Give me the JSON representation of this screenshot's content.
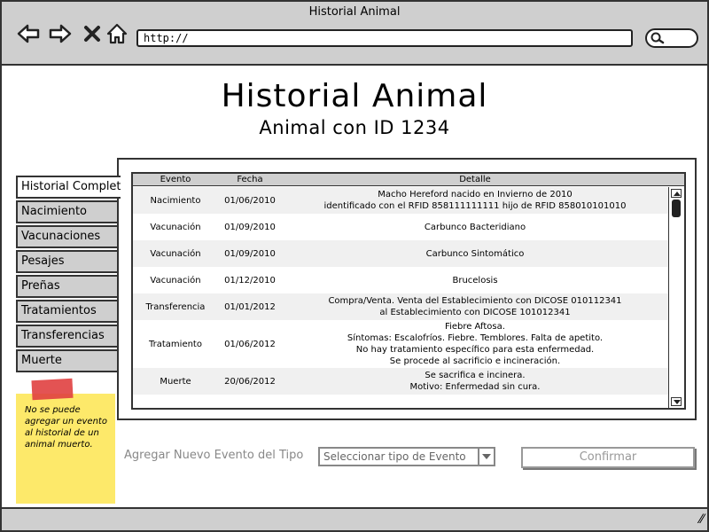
{
  "window": {
    "title": "Historial Animal"
  },
  "toolbar": {
    "url": "http://"
  },
  "page": {
    "title": "Historial Animal",
    "subtitle": "Animal con ID 1234"
  },
  "tabs": [
    {
      "label": "Historial Completo",
      "active": true
    },
    {
      "label": "Nacimiento"
    },
    {
      "label": "Vacunaciones"
    },
    {
      "label": "Pesajes"
    },
    {
      "label": "Preñas"
    },
    {
      "label": "Tratamientos"
    },
    {
      "label": "Transferencias"
    },
    {
      "label": "Muerte"
    }
  ],
  "table": {
    "headers": {
      "evento": "Evento",
      "fecha": "Fecha",
      "detalle": "Detalle"
    },
    "rows": [
      {
        "evento": "Nacimiento",
        "fecha": "01/06/2010",
        "detalle": "Macho Hereford nacido en Invierno de 2010\nidentificado con el RFID 858111111111 hijo de RFID 858010101010"
      },
      {
        "evento": "Vacunación",
        "fecha": "01/09/2010",
        "detalle": "Carbunco Bacteridiano"
      },
      {
        "evento": "Vacunación",
        "fecha": "01/09/2010",
        "detalle": "Carbunco Sintomático"
      },
      {
        "evento": "Vacunación",
        "fecha": "01/12/2010",
        "detalle": "Brucelosis"
      },
      {
        "evento": "Transferencia",
        "fecha": "01/01/2012",
        "detalle": "Compra/Venta. Venta del Establecimiento con DICOSE 010112341\nal Establecimiento con DICOSE 101012341"
      },
      {
        "evento": "Tratamiento",
        "fecha": "01/06/2012",
        "detalle": "Fiebre Aftosa.\nSíntomas: Escalofríos. Fiebre. Temblores. Falta de apetito.\nNo hay tratamiento específico para esta enfermedad.\nSe procede al sacrificio e incineración."
      },
      {
        "evento": "Muerte",
        "fecha": "20/06/2012",
        "detalle": "Se sacrifica e incinera.\nMotivo: Enfermedad sin cura."
      }
    ]
  },
  "note": {
    "text": "No se puede agregar un evento al historial de un animal muerto."
  },
  "add_event": {
    "label": "Agregar Nuevo Evento del Tipo",
    "select_placeholder": "Seleccionar tipo de Evento",
    "confirm_label": "Confirmar"
  },
  "colors": {
    "chrome": "#cfcfcf",
    "note": "#fde96a",
    "tape": "#e04040",
    "disabled": "#999999"
  }
}
